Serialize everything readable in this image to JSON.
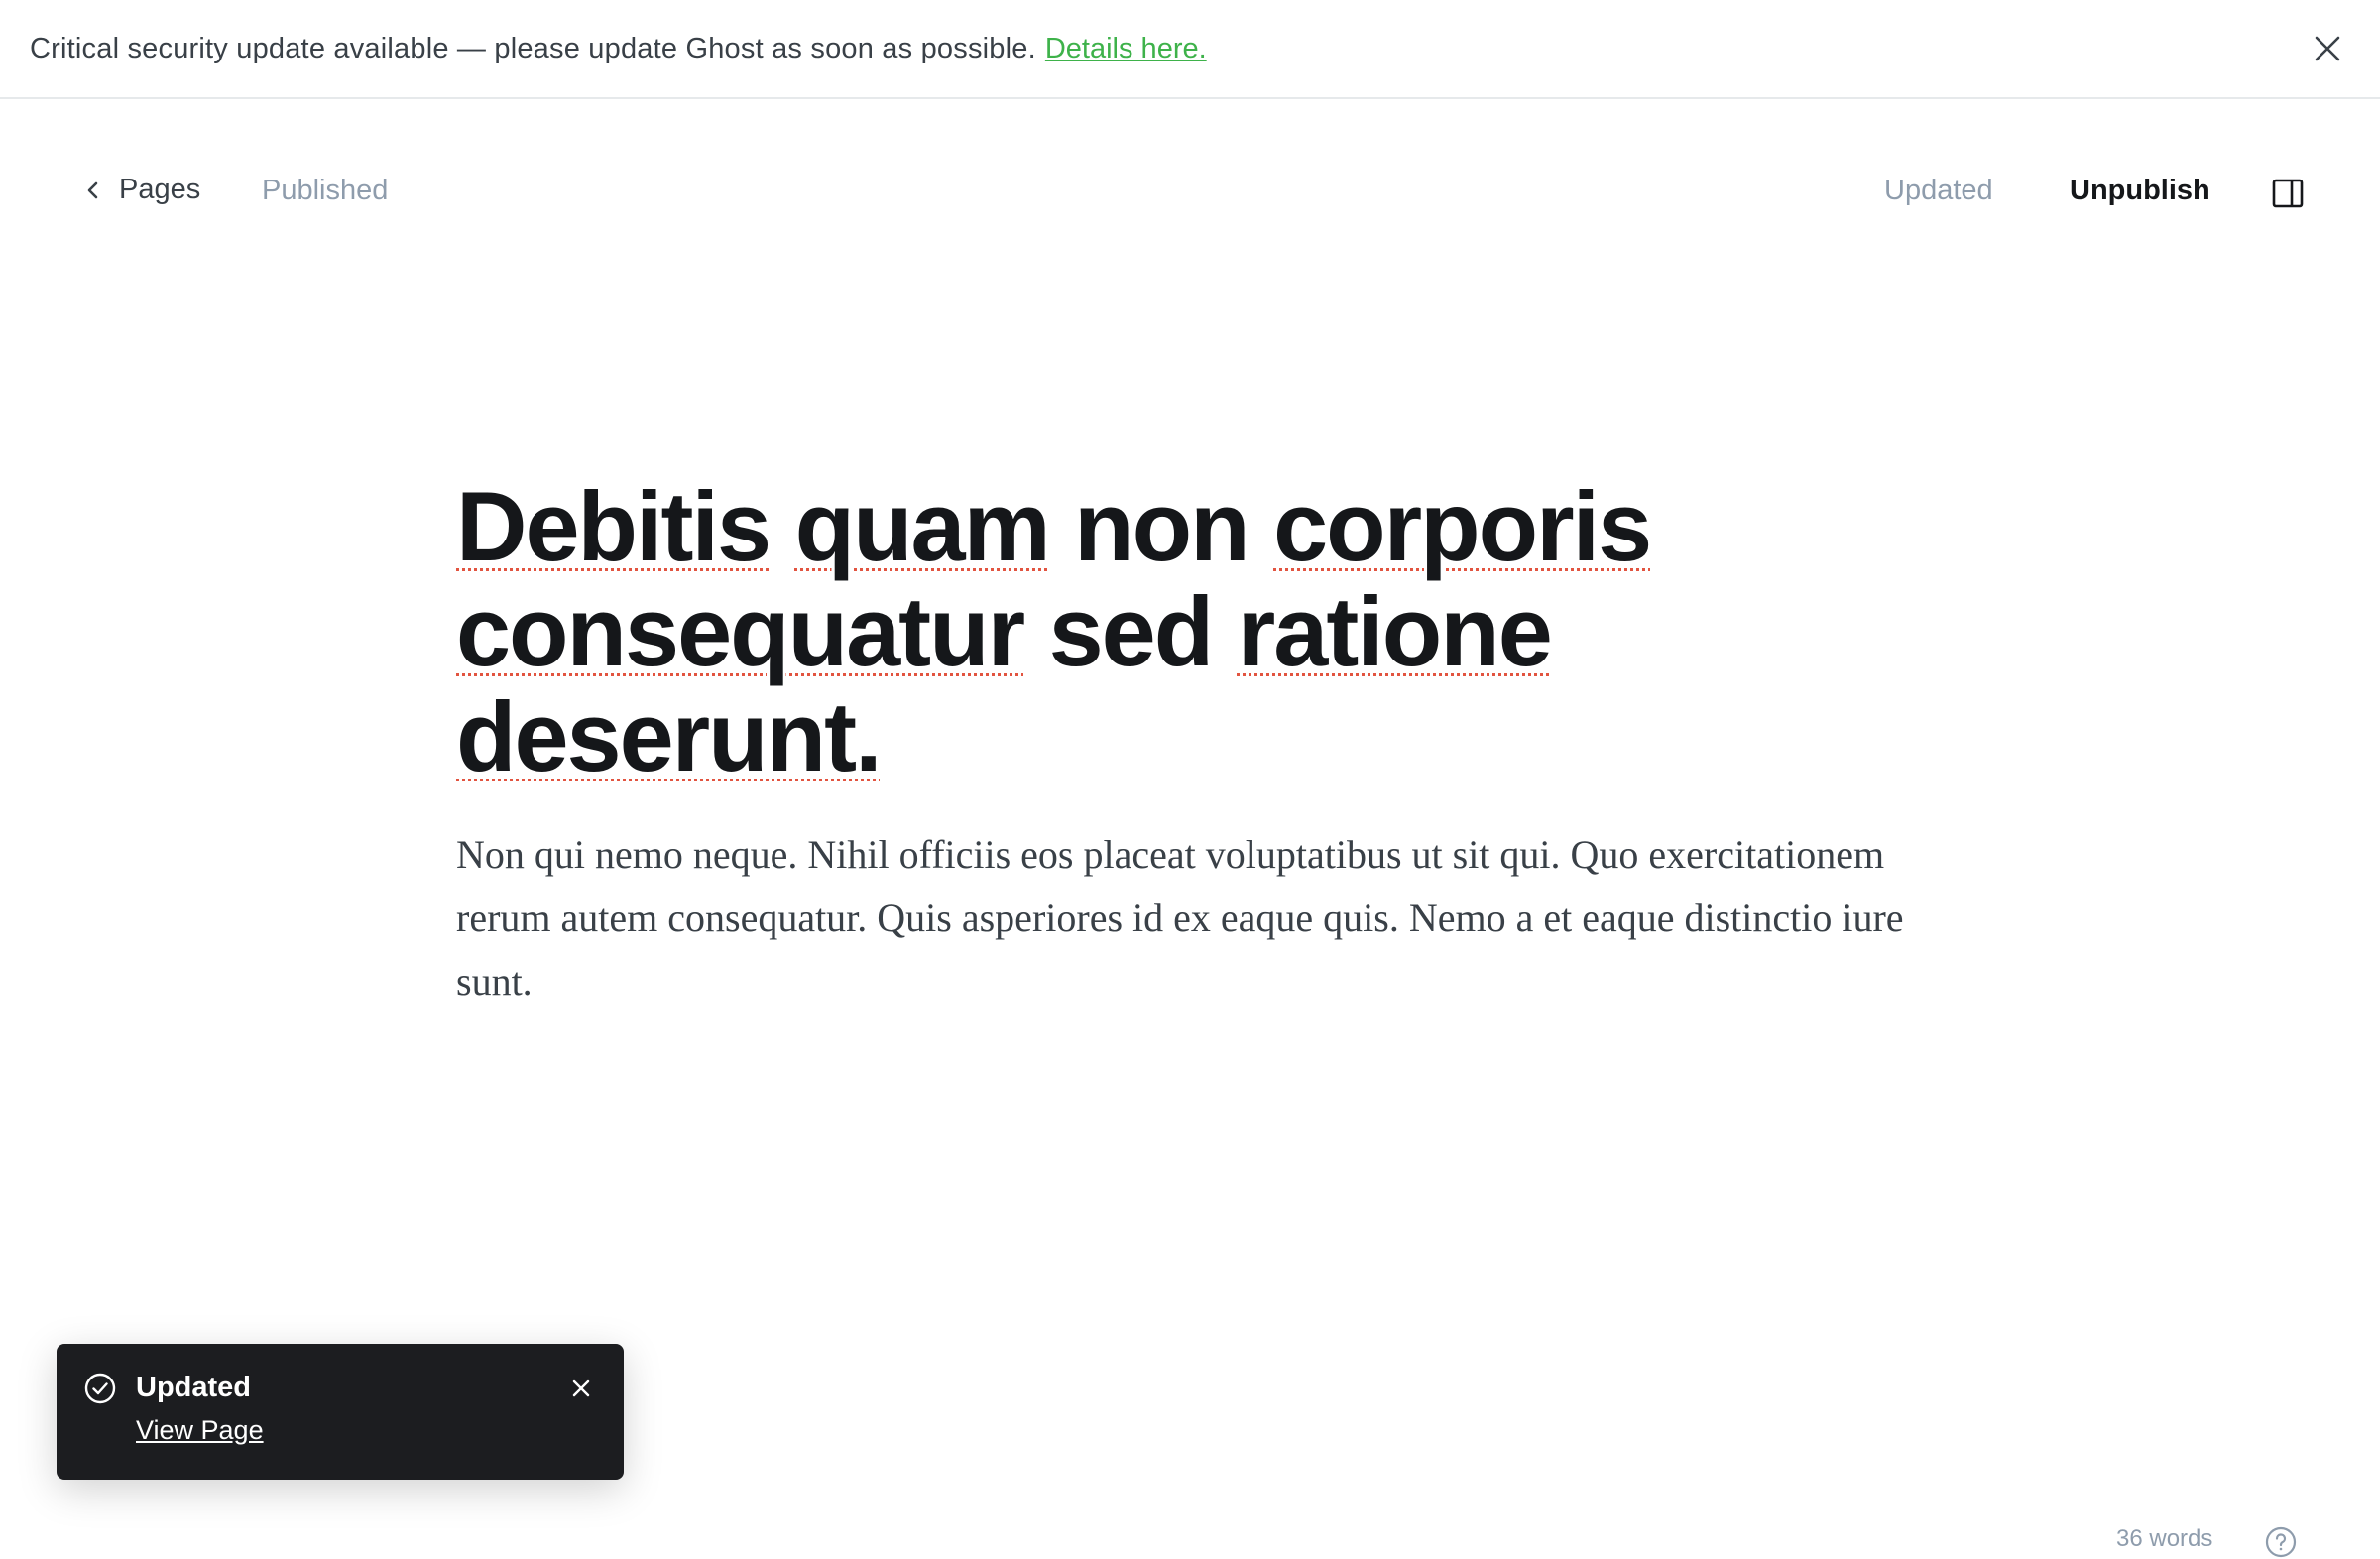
{
  "banner": {
    "message": "Critical security update available — please update Ghost as soon as possible.",
    "link_label": "Details here.",
    "close_icon": "close-icon",
    "link_color": "#3eb24a"
  },
  "header": {
    "back_label": "Pages",
    "back_icon": "chevron-left-icon",
    "status": "Published",
    "save_status": "Updated",
    "unpublish_label": "Unpublish",
    "sidebar_icon": "sidebar-toggle-icon"
  },
  "editor": {
    "title_words": [
      "Debitis",
      "quam",
      "non",
      "corporis",
      "consequatur",
      "sed",
      "ratione",
      "deserunt."
    ],
    "body": "Non qui nemo neque. Nihil officiis eos placeat voluptatibus ut sit qui. Quo exercitationem rerum autem consequatur. Quis asperiores id ex eaque quis. Nemo a et eaque distinctio iure sunt."
  },
  "toast": {
    "title": "Updated",
    "link_label": "View Page",
    "check_icon": "check-circle-icon",
    "close_icon": "close-icon",
    "background": "#1c1d20"
  },
  "footer": {
    "word_count": "36 words",
    "help_icon": "help-circle-icon"
  }
}
